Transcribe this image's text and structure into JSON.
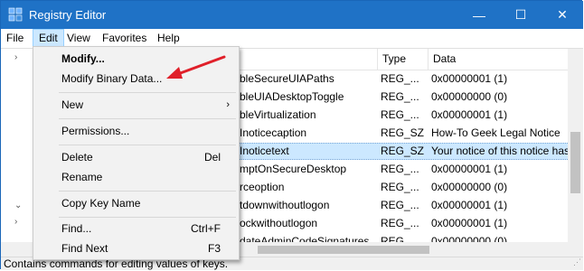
{
  "window": {
    "title": "Registry Editor"
  },
  "caption_buttons": {
    "minimize": "—",
    "maximize": "☐",
    "close": "✕"
  },
  "menubar": [
    "File",
    "Edit",
    "View",
    "Favorites",
    "Help"
  ],
  "list": {
    "columns": {
      "type": "Type",
      "data": "Data"
    },
    "rows": [
      {
        "name": "bleSecureUIAPaths",
        "type": "REG_...",
        "data": "0x00000001 (1)"
      },
      {
        "name": "bleUIADesktopToggle",
        "type": "REG_...",
        "data": "0x00000000 (0)"
      },
      {
        "name": "bleVirtualization",
        "type": "REG_...",
        "data": "0x00000001 (1)"
      },
      {
        "name": "Inoticecaption",
        "type": "REG_SZ",
        "data": "How-To Geek Legal Notice"
      },
      {
        "name": "Inoticetext",
        "type": "REG_SZ",
        "data": "Your notice of this notice has"
      },
      {
        "name": "mptOnSecureDesktop",
        "type": "REG_...",
        "data": "0x00000001 (1)"
      },
      {
        "name": "rceoption",
        "type": "REG_...",
        "data": "0x00000000 (0)"
      },
      {
        "name": "tdownwithoutlogon",
        "type": "REG_...",
        "data": "0x00000001 (1)"
      },
      {
        "name": "ockwithoutlogon",
        "type": "REG_...",
        "data": "0x00000001 (1)"
      },
      {
        "name": "dateAdminCodeSignatures",
        "type": "REG_...",
        "data": "0x00000000 (0)"
      }
    ]
  },
  "edit_menu": {
    "modify": "Modify...",
    "modify_binary": "Modify Binary Data...",
    "new": "New",
    "permissions": "Permissions...",
    "delete": "Delete",
    "delete_shortcut": "Del",
    "rename": "Rename",
    "copy_key_name": "Copy Key Name",
    "find": "Find...",
    "find_shortcut": "Ctrl+F",
    "find_next": "Find Next",
    "find_next_shortcut": "F3"
  },
  "statusbar": {
    "text": "Contains commands for editing values of keys."
  },
  "colors": {
    "titlebar": "#1f72c6",
    "menu_highlight": "#cce8ff",
    "annotation_arrow": "#e0202a"
  },
  "icons": {
    "app": "registry-editor-icon",
    "submenu": "chevron-right-icon"
  }
}
